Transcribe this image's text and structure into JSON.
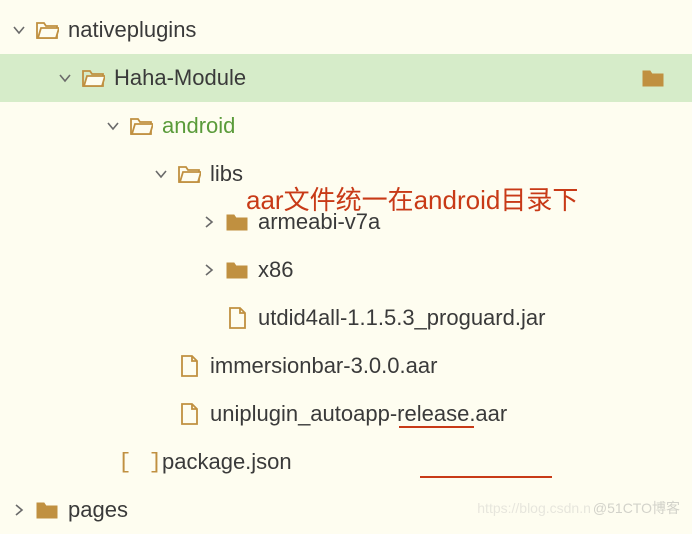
{
  "tree": {
    "nativeplugins": "nativeplugins",
    "haha": "Haha-Module",
    "android": "android",
    "libs": "libs",
    "armeabi": "armeabi-v7a",
    "x86": "x86",
    "utdid": "utdid4all-1.1.5.3_proguard.jar",
    "immersion": "immersionbar-3.0.0.aar",
    "uniplugin": "uniplugin_autoapp-release.aar",
    "package": "package.json",
    "pages": "pages"
  },
  "annotation": "aar文件统一在android目录下",
  "watermark_left": "https://blog.csdn.n",
  "watermark_right": "@51CTO博客",
  "colors": {
    "bg": "#fefdf0",
    "selected": "#d6ecc9",
    "folder": "#c09040",
    "greenText": "#5a9b3a",
    "annotation": "#c83a17"
  }
}
